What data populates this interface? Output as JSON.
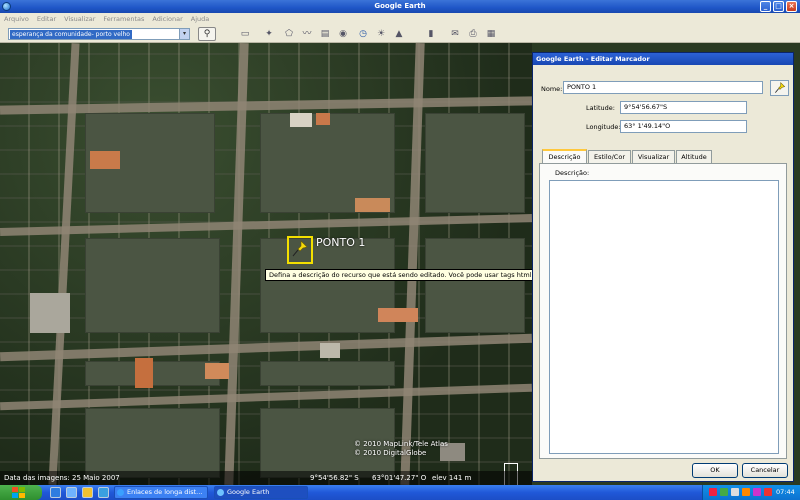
{
  "window": {
    "title": "Google Earth"
  },
  "menu": [
    "Arquivo",
    "Editar",
    "Visualizar",
    "Ferramentas",
    "Adicionar",
    "Ajuda"
  ],
  "search": {
    "value": "esperança da comunidade- porto velho"
  },
  "map": {
    "placemark_label": "PONTO 1",
    "tooltip": "Defina a descrição do recurso que está sendo editado. Você pode usar tags html e incluir URLs.",
    "copyright_line1": "© 2010 MapLink/Tele Atlas",
    "copyright_line2": "© 2010 DigitalGlobe"
  },
  "status": {
    "imagery_date": "Data das imagens: 25 Maio 2007",
    "lat": "9°54'56.82\" S",
    "lon": "63°01'47.27\" O",
    "elev": "elev  141 m"
  },
  "dialog": {
    "title": "Google Earth - Editar Marcador",
    "name_label": "Nome:",
    "name_value": "PONTO 1",
    "lat_label": "Latitude:",
    "lat_value": "9°54'56.67\"S",
    "lon_label": "Longitude:",
    "lon_value": "63° 1'49.14\"O",
    "tabs": [
      "Descrição",
      "Estilo/Cor",
      "Visualizar",
      "Altitude"
    ],
    "desc_label": "Descrição:",
    "ok": "OK",
    "cancel": "Cancelar"
  },
  "taskbar": {
    "tasks": [
      "Enlaces de longa dist...",
      "Google Earth"
    ],
    "clock": "07:44"
  }
}
